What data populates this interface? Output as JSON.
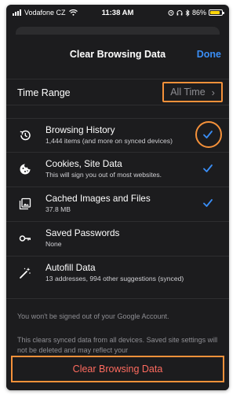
{
  "status_bar": {
    "carrier": "Vodafone CZ",
    "time": "11:38 AM",
    "battery": "86%",
    "battery_level": 0.86,
    "icons": [
      "signal-icon",
      "wifi-icon",
      "alarm-icon",
      "headphones-icon",
      "bluetooth-icon",
      "battery-icon"
    ]
  },
  "nav": {
    "title": "Clear Browsing Data",
    "done_label": "Done"
  },
  "time_range": {
    "label": "Time Range",
    "value": "All Time"
  },
  "items": [
    {
      "title": "Browsing History",
      "subtitle": "1,444 items (and more on synced devices)",
      "icon": "history-icon",
      "checked": true,
      "highlighted": true
    },
    {
      "title": "Cookies, Site Data",
      "subtitle": "This will sign you out of most websites.",
      "icon": "cookie-icon",
      "checked": true
    },
    {
      "title": "Cached Images and Files",
      "subtitle": "37.8 MB",
      "icon": "image-icon",
      "checked": true
    },
    {
      "title": "Saved Passwords",
      "subtitle": "None",
      "icon": "key-icon",
      "checked": false
    },
    {
      "title": "Autofill Data",
      "subtitle": "13 addresses, 994 other suggestions (synced)",
      "icon": "magic-wand-icon",
      "checked": false
    }
  ],
  "notes": {
    "account": "You won't be signed out of your Google Account.",
    "synced": "This clears synced data from all devices. Saved site settings will not be deleted and may reflect your"
  },
  "clear_button": {
    "label": "Clear Browsing Data"
  },
  "colors": {
    "accent_blue": "#3a8ef6",
    "highlight_orange": "#f5913a",
    "destructive_red": "#ff6b5f",
    "background": "#1c1c1e"
  }
}
